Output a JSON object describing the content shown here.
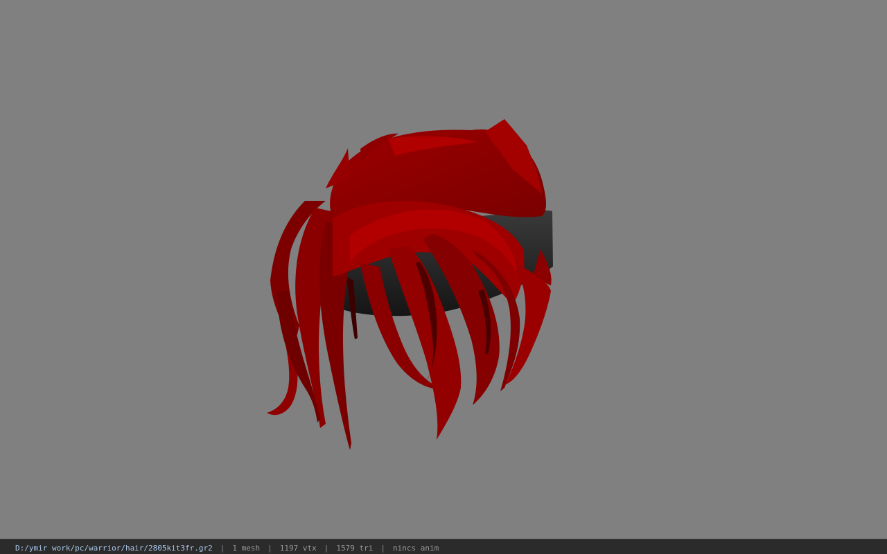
{
  "viewport": {
    "background": "#808080",
    "model_colors": {
      "hair": "#a00000",
      "hair_dark": "#6a0000",
      "hair_shadow": "#3c0000",
      "band": "#262626"
    }
  },
  "statusbar": {
    "file_path": "D:/ymir work/pc/warrior/hair/2805kit3fr.gr2",
    "separator": "|",
    "mesh_count": "1 mesh",
    "vertex_count": "1197 vtx",
    "triangle_count": "1579 tri",
    "anim_status": "nincs anim"
  }
}
